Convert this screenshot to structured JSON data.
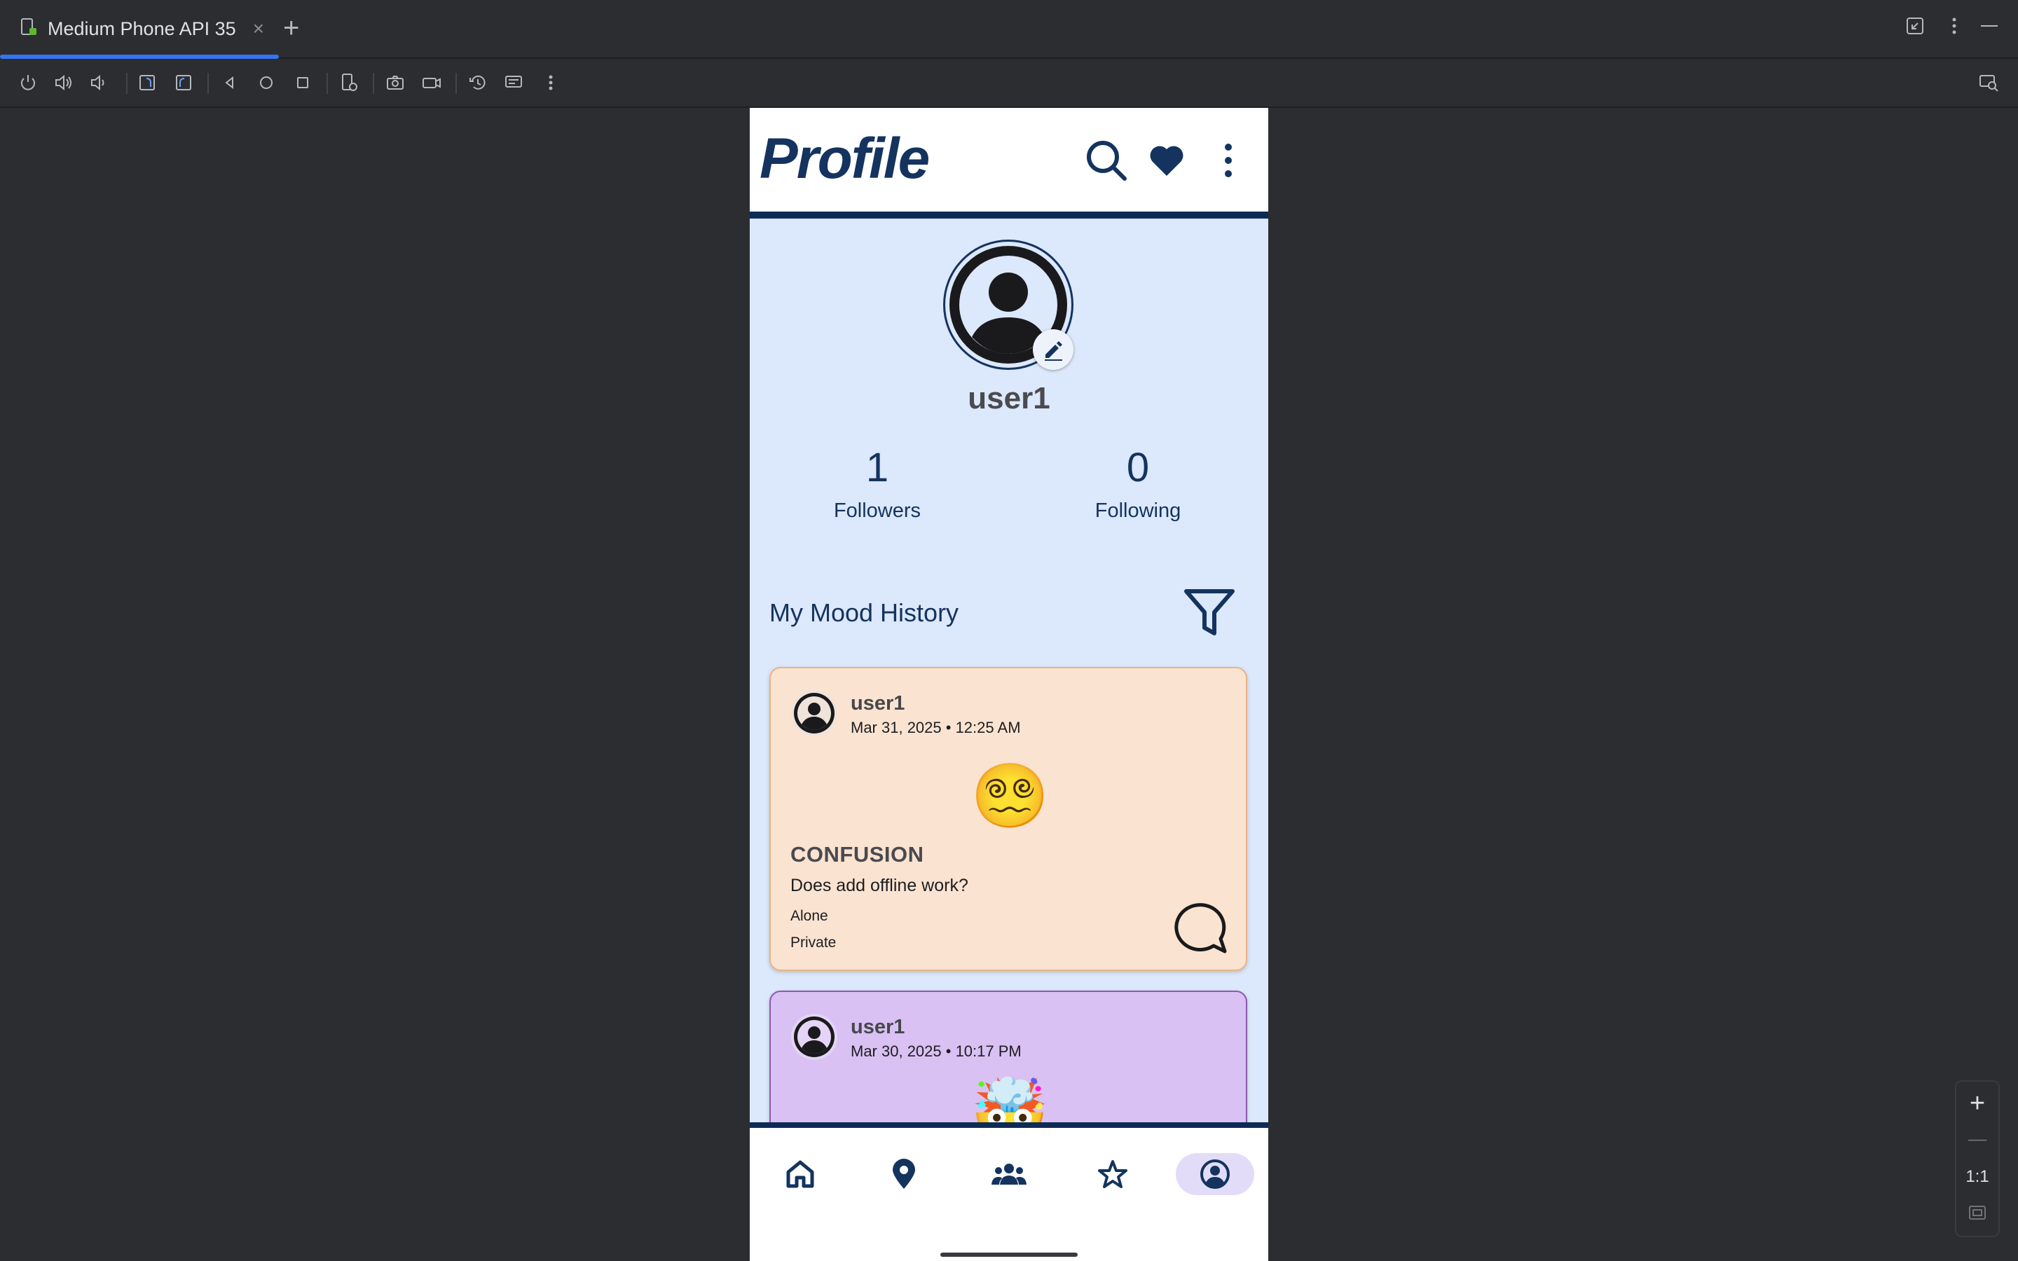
{
  "ide": {
    "tab_title": "Medium Phone API 35",
    "tab_close": "×",
    "tab_add": "+",
    "zoom": {
      "plus": "+",
      "minus": "—",
      "ratio": "1:1"
    },
    "accent_color": "#3574f0"
  },
  "app": {
    "title": "Profile",
    "brand_color": "#14335f",
    "profile": {
      "username": "user1",
      "followers_count": "1",
      "followers_label": "Followers",
      "following_count": "0",
      "following_label": "Following"
    },
    "section_title": "My Mood History",
    "posts": [
      {
        "user": "user1",
        "date": "Mar 31, 2025 • 12:25 AM",
        "emoji": "😵‍💫",
        "mood": "CONFUSION",
        "text": "Does add offline work?",
        "social": "Alone",
        "privacy": "Private",
        "color": "#fae3d1"
      },
      {
        "user": "user1",
        "date": "Mar 30, 2025 • 10:17 PM",
        "emoji": "🤯",
        "color": "#d9c1f3"
      }
    ],
    "nav": [
      "home-icon",
      "location-icon",
      "groups-icon",
      "star-icon",
      "account-icon"
    ],
    "nav_active": "account-icon"
  }
}
